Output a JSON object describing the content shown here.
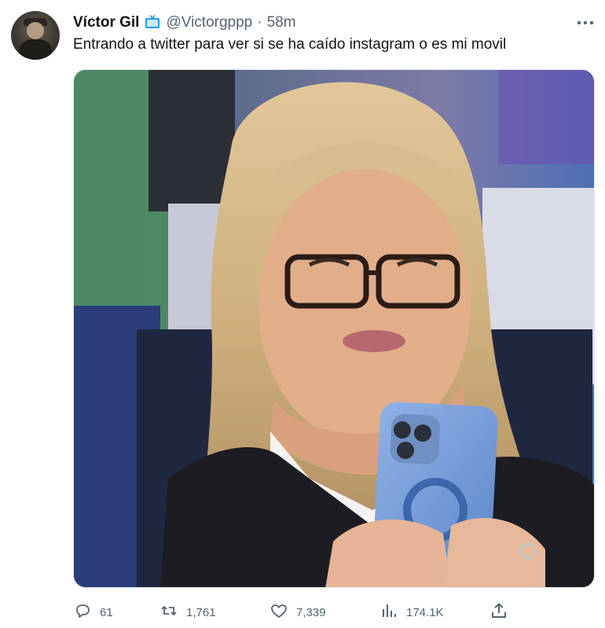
{
  "tweet": {
    "display_name": "Víctor Gil",
    "badge_icon": "tv-icon",
    "handle": "@Victorgppp",
    "separator": "·",
    "time": "58m",
    "text": "Entrando a twitter para ver si se ha caído instagram o es mi movil",
    "more_icon": "ellipsis-icon",
    "media_description": "photo of blonde woman with glasses looking at a blue phone"
  },
  "actions": {
    "replies": "61",
    "retweets": "1,761",
    "likes": "7,339",
    "views": "174.1K"
  },
  "colors": {
    "text_primary": "#0f1419",
    "text_secondary": "#536471",
    "badge_blue": "#1d9bf0"
  }
}
